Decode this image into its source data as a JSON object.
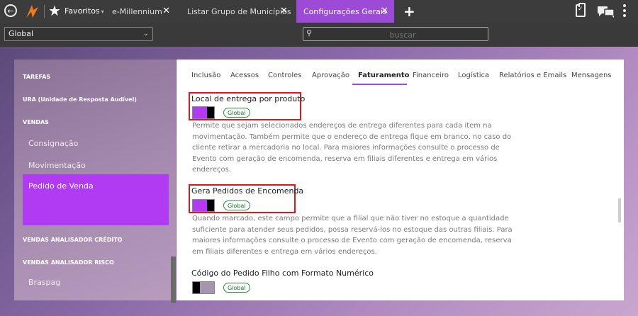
{
  "topbar": {
    "favorites_label": "Favoritos",
    "tabs": [
      {
        "label": "e-Millennium"
      },
      {
        "label": "Listar Grupo de Municípios"
      },
      {
        "label": "Configurações Gerais"
      }
    ],
    "close_symbol": "✕",
    "add_symbol": "+"
  },
  "subbar": {
    "scope_select": "Global",
    "search_placeholder": "buscar"
  },
  "sidebar": {
    "items": [
      {
        "label": "TAREFAS"
      },
      {
        "label": "URA (Unidade de Resposta Audível)"
      },
      {
        "label": "VENDAS"
      },
      {
        "label": "Consignação"
      },
      {
        "label": "Movimentação"
      },
      {
        "label": "Pedido de Venda"
      },
      {
        "label": "VENDAS ANALISADOR CRÉDITO"
      },
      {
        "label": "VENDAS ANALISADOR RISCO"
      },
      {
        "label": "Braspag"
      }
    ]
  },
  "panel": {
    "tabs": [
      {
        "label": "Inclusão"
      },
      {
        "label": "Acessos"
      },
      {
        "label": "Controles"
      },
      {
        "label": "Aprovação"
      },
      {
        "label": "Faturamento"
      },
      {
        "label": "Financeiro"
      },
      {
        "label": "Logística"
      },
      {
        "label": "Relatórios e Emails"
      },
      {
        "label": "Mensagens"
      }
    ],
    "active_tab": "Faturamento",
    "settings": [
      {
        "title": "Local de entrega por produto",
        "enabled": true,
        "badge": "Global",
        "description_lines": [
          "Permite que sejam selecionados endereços de entrega diferentes para cada item na",
          "movimentação. Também permite que o endereço de entrega fique em branco, no caso do",
          "cliente retirar a mercadoria no local. Para maiores informações consulte o processo de",
          "Evento com geração de encomenda, reserva em filiais diferentes e entrega em vários",
          "endereços."
        ]
      },
      {
        "title": "Gera Pedidos de Encomenda",
        "enabled": true,
        "badge": "Global",
        "description_lines": [
          "Quando marcado, este campo permite que a filial que não tiver no estoque a quantidade",
          "suficiente para atender seus pedidos, possa reservá-los no estoque das outras filiais. Para",
          "maiores informações consulte o processo de Evento com geração de encomenda, reserva",
          "em filiais diferentes e entrega em vários endereços."
        ]
      },
      {
        "title": "Código do Pedido Filho com Formato Numérico",
        "enabled": false,
        "badge": "Global",
        "description_lines": []
      }
    ]
  },
  "colors": {
    "accent": "#9c4bd6",
    "toggle_on": "#b03bf2",
    "badge_green": "#2e8b3a",
    "highlight_red": "#e0161a"
  }
}
